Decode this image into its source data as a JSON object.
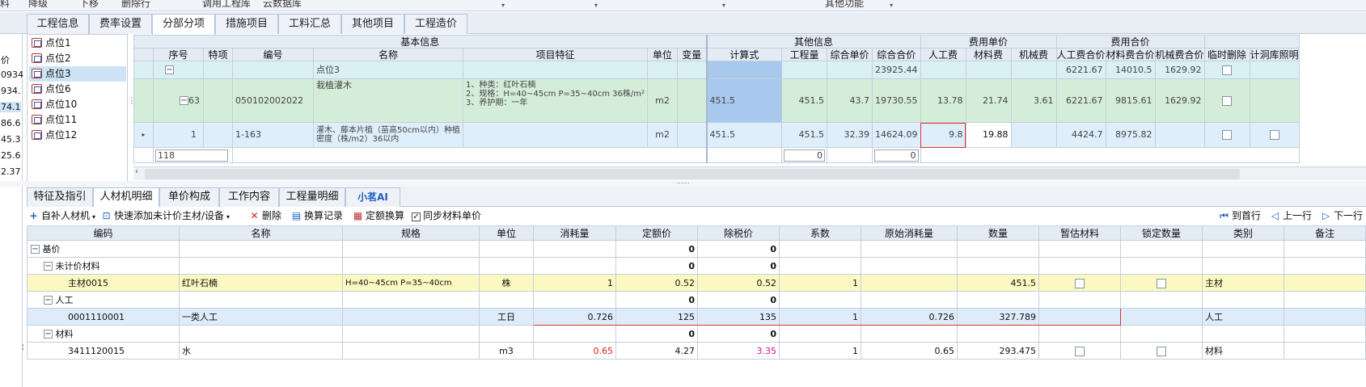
{
  "toolbar_top": {
    "items": [
      "料",
      "降级",
      "下移",
      "删除行",
      "调用工程库",
      "云数据库",
      "其他功能"
    ]
  },
  "main_tabs": [
    "工程信息",
    "费率设置",
    "分部分项",
    "措施项目",
    "工料汇总",
    "其他项目",
    "工程造价"
  ],
  "main_tabs_active": 2,
  "left_values": [
    "0934",
    "934.",
    "74.1",
    "86.6",
    "45.3",
    "25.6",
    "2.37"
  ],
  "left_label": "价",
  "tree": {
    "items": [
      "点位1",
      "点位2",
      "点位3",
      "点位6",
      "点位10",
      "点位11",
      "点位12"
    ],
    "selected": 2
  },
  "grid1": {
    "group_headers": {
      "basic": "基本信息",
      "other": "其他信息",
      "unit_cost": "费用单价",
      "total_cost": "费用合价"
    },
    "columns": [
      "序号",
      "特项",
      "编号",
      "名称",
      "项目特征",
      "单位",
      "变量",
      "计算式",
      "工程量",
      "综合单价",
      "综合合价",
      "人工费",
      "材料费",
      "机械费",
      "人工费合价",
      "材料费合价",
      "机械费合价",
      "临时删除",
      "计洞库照明"
    ],
    "rows": [
      {
        "seq": "",
        "code": "",
        "name": "点位3",
        "feature": "",
        "unit": "",
        "calc": "",
        "qty": "",
        "price": "",
        "total": "23925.44",
        "labor": "",
        "mat": "",
        "mach": "",
        "labor_total": "6221.67",
        "mat_total": "14010.5",
        "mach_total": "1629.92"
      },
      {
        "seq": "63",
        "code": "050102002022",
        "name": "栽植灌木",
        "feature": "1、种类：红叶石楠\n2、规格：H=40~45cm P=35~40cm 36株/m²\n3、养护期：一年",
        "unit": "m2",
        "calc": "451.5",
        "qty": "451.5",
        "price": "43.7",
        "total": "19730.55",
        "labor": "13.78",
        "mat": "21.74",
        "mach": "3.61",
        "labor_total": "6221.67",
        "mat_total": "9815.61",
        "mach_total": "1629.92"
      },
      {
        "seq": "1",
        "code": "1-163",
        "name": "灌木、藤本片植（苗高50cm以内）种植密度（株/m2）36以内",
        "feature": "",
        "unit": "m2",
        "calc": "451.5",
        "qty": "451.5",
        "price": "32.39",
        "total": "14624.09",
        "labor": "9.8",
        "mat": "19.88",
        "mach": "",
        "labor_total": "4424.7",
        "mat_total": "8975.82",
        "mach_total": ""
      }
    ],
    "sum_row": {
      "seq": "118",
      "qty": "0",
      "total": "0"
    }
  },
  "bottom_tabs": [
    "特征及指引",
    "人材机明细",
    "单价构成",
    "工作内容",
    "工程量明细",
    "小茗AI"
  ],
  "bottom_tabs_active": 1,
  "tool2": {
    "add_material": "自补人材机",
    "quick_add": "快速添加未计价主材/设备",
    "delete": "删除",
    "convert_record": "换算记录",
    "quota_convert": "定额换算",
    "sync_price": "同步材料单价",
    "first_row": "到首行",
    "prev_row": "上一行",
    "next_row": "下一行"
  },
  "grid2": {
    "columns": [
      "编码",
      "名称",
      "规格",
      "单位",
      "消耗量",
      "定额价",
      "除税价",
      "系数",
      "原始消耗量",
      "数量",
      "暂估材料",
      "锁定数量",
      "类别",
      "备注"
    ],
    "rows": [
      {
        "level": 0,
        "code": "基价",
        "name": "",
        "spec": "",
        "unit": "",
        "consume": "",
        "quota": "0",
        "notax": "0",
        "coef": "",
        "orig": "",
        "qty": "",
        "cat": "",
        "style": "grp"
      },
      {
        "level": 1,
        "code": "未计价材料",
        "name": "",
        "spec": "",
        "unit": "",
        "consume": "",
        "quota": "0",
        "notax": "0",
        "coef": "",
        "orig": "",
        "qty": "",
        "cat": "",
        "style": "grp"
      },
      {
        "level": 2,
        "code": "主材0015",
        "name": "红叶石楠",
        "spec": "H=40~45cm P=35~40cm",
        "unit": "株",
        "consume": "1",
        "quota": "0.52",
        "notax": "0.52",
        "coef": "1",
        "orig": "",
        "qty": "451.5",
        "cat": "主材",
        "style": "ylw"
      },
      {
        "level": 1,
        "code": "人工",
        "name": "",
        "spec": "",
        "unit": "",
        "consume": "",
        "quota": "0",
        "notax": "0",
        "coef": "",
        "orig": "",
        "qty": "",
        "cat": "",
        "style": "grp"
      },
      {
        "level": 2,
        "code": "0001110001",
        "name": "一类人工",
        "spec": "",
        "unit": "工日",
        "consume": "0.726",
        "quota": "125",
        "notax": "135",
        "coef": "1",
        "orig": "0.726",
        "qty": "327.789",
        "cat": "人工",
        "style": "blu"
      },
      {
        "level": 1,
        "code": "材料",
        "name": "",
        "spec": "",
        "unit": "",
        "consume": "",
        "quota": "0",
        "notax": "0",
        "coef": "",
        "orig": "",
        "qty": "",
        "cat": "",
        "style": "grp"
      },
      {
        "level": 2,
        "code": "3411120015",
        "name": "水",
        "spec": "",
        "unit": "m3",
        "consume": "0.65",
        "quota": "4.27",
        "notax": "3.35",
        "coef": "1",
        "orig": "0.65",
        "qty": "293.475",
        "cat": "材料",
        "style": "plain"
      }
    ]
  },
  "colors": {
    "accent": "#1e5fbf",
    "highlight_blue": "#a9c8ee",
    "red_text": "#e02020",
    "pink_text": "#d0188c"
  }
}
